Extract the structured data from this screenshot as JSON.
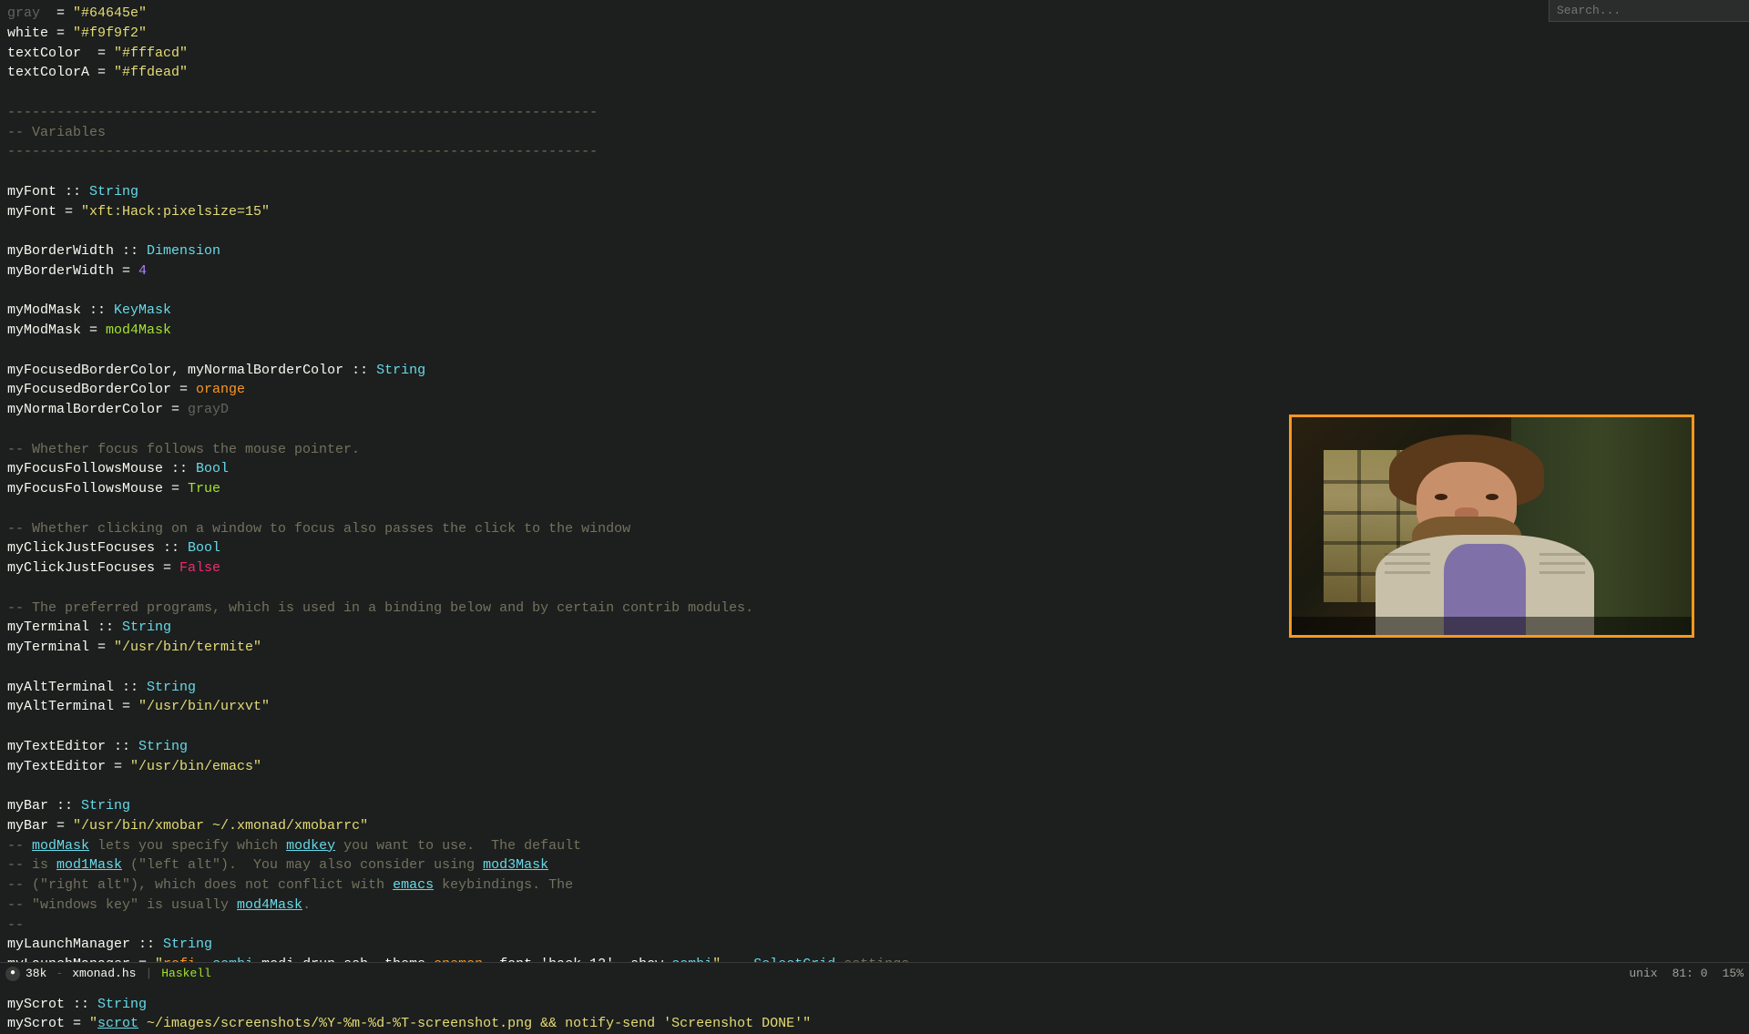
{
  "editor": {
    "lines": [
      {
        "id": 1,
        "content": "gray  = \"#64645e\"",
        "parts": [
          {
            "text": "gray",
            "cls": "kw-gray"
          },
          {
            "text": "  = ",
            "cls": "kw-white"
          },
          {
            "text": "\"#64645e\"",
            "cls": "kw-string"
          }
        ]
      },
      {
        "id": 2,
        "content": "white = \"#f9f9f2\"",
        "parts": [
          {
            "text": "white",
            "cls": "kw-white"
          },
          {
            "text": " = ",
            "cls": "kw-white"
          },
          {
            "text": "\"#f9f9f2\"",
            "cls": "kw-string"
          }
        ]
      },
      {
        "id": 3,
        "content": "textColor  = \"#fffacd\"",
        "parts": [
          {
            "text": "textColor",
            "cls": "kw-white"
          },
          {
            "text": "  = ",
            "cls": "kw-white"
          },
          {
            "text": "\"#fffacd\"",
            "cls": "kw-string"
          }
        ]
      },
      {
        "id": 4,
        "content": "textColorA = \"#ffdead\"",
        "parts": [
          {
            "text": "textColorA",
            "cls": "kw-white"
          },
          {
            "text": " = ",
            "cls": "kw-white"
          },
          {
            "text": "\"#ffdead\"",
            "cls": "kw-string"
          }
        ]
      }
    ],
    "sep1": "------------------------------------------------------------------------",
    "sep2": "------------------------------------------------------------------------",
    "var_comment": "-- Variables",
    "body_lines_raw": [
      "myFont :: String",
      "myFont = \"xft:Hack:pixelsize=15\"",
      "",
      "myBorderWidth :: Dimension",
      "myBorderWidth = 4",
      "",
      "myModMask :: KeyMask",
      "myModMask = mod4Mask",
      "",
      "myFocusedBorderColor, myNormalBorderColor :: String",
      "myFocusedBorderColor = orange",
      "myNormalBorderColor = grayD",
      "",
      "-- Whether focus follows the mouse pointer.",
      "myFocusFollowsMouse :: Bool",
      "myFocusFollowsMouse = True",
      "",
      "-- Whether clicking on a window to focus also passes the click to the window",
      "myClickJustFocuses :: Bool",
      "myClickJustFocuses = False",
      "",
      "-- The preferred programs, which is used in a binding below and by certain contrib modules.",
      "myTerminal :: String",
      "myTerminal = \"/usr/bin/termite\"",
      "",
      "myAltTerminal :: String",
      "myAltTerminal = \"/usr/bin/urxvt\"",
      "",
      "myTextEditor :: String",
      "myTextEditor = \"/usr/bin/emacs\"",
      "",
      "myBar :: String",
      "myBar = \"/usr/bin/xmobar ~/.xmonad/xmobarrc\"",
      "-- modMask lets you specify which modkey you want to use.  The default",
      "-- is mod1Mask (\"left alt\").  You may also consider using mod3Mask",
      "-- (\"right alt\"), which does not conflict with emacs keybindings. The",
      "-- \"windows key\" is usually mod4Mask.",
      "--",
      "myLaunchManager :: String",
      "myLaunchManager = \"rofi -combi-modi drun,ssh -theme onemon -font 'hack 12' -show combi\" -- SelectGrid settings",
      "",
      "myScrot :: String",
      "myScrot = \"scrot ~/images/screenshots/%Y-%m-%d-%T-screenshot.png && notify-send 'Screenshot DONE'\""
    ]
  },
  "statusbar": {
    "icon": "●",
    "file_size": "38k",
    "filename": "xmonad.hs",
    "filetype": "Haskell",
    "encoding": "unix",
    "cursor": "81: 0",
    "scroll": "15%",
    "search_placeholder": "Search..."
  },
  "video": {
    "border_color": "#fd971f",
    "description": "Video overlay showing person"
  }
}
